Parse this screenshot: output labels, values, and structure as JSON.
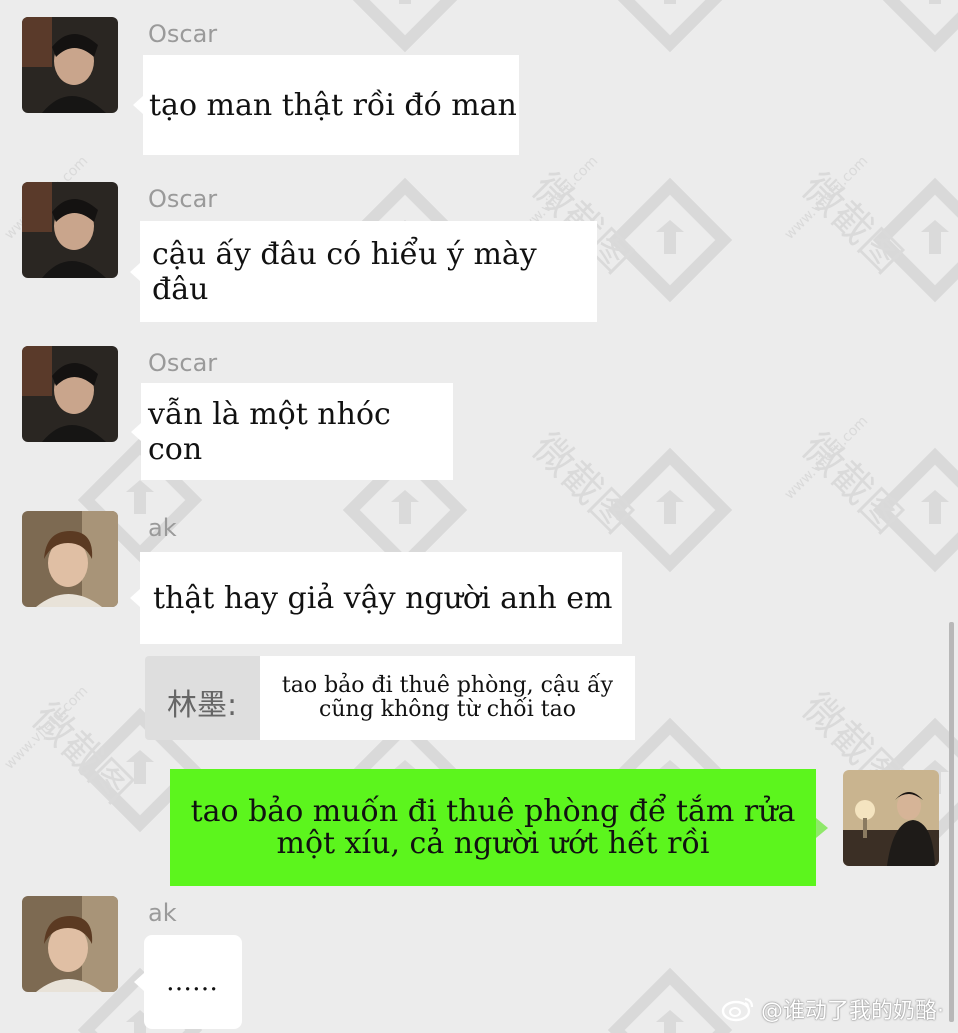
{
  "messages": [
    {
      "sender": "Oscar",
      "text": "tạo man thật rồi đó man"
    },
    {
      "sender": "Oscar",
      "text": "cậu ấy đâu có hiểu ý mày đâu"
    },
    {
      "sender": "Oscar",
      "text": "vẫn là một nhóc con"
    },
    {
      "sender": "ak",
      "text": "thật hay giả vậy người anh em"
    },
    {
      "quote_sender": "林墨:",
      "quote_line1": "tao bảo đi thuê phòng, cậu ấy",
      "quote_line2": "cũng không từ chối tao"
    },
    {
      "outgoing_line1": "tao bảo muốn đi thuê phòng để tắm rửa",
      "outgoing_line2": "một xíu, cả người ướt hết rồi"
    },
    {
      "sender": "ak",
      "text": "……"
    }
  ],
  "watermark": {
    "text": "微截图",
    "url": "www.vjietu.com"
  },
  "credit": {
    "text": "@谁动了我的奶酪·",
    "icon": "weibo-icon"
  },
  "colors": {
    "background": "#ececec",
    "outgoing_bubble": "#5cf51d",
    "incoming_bubble": "#ffffff"
  }
}
